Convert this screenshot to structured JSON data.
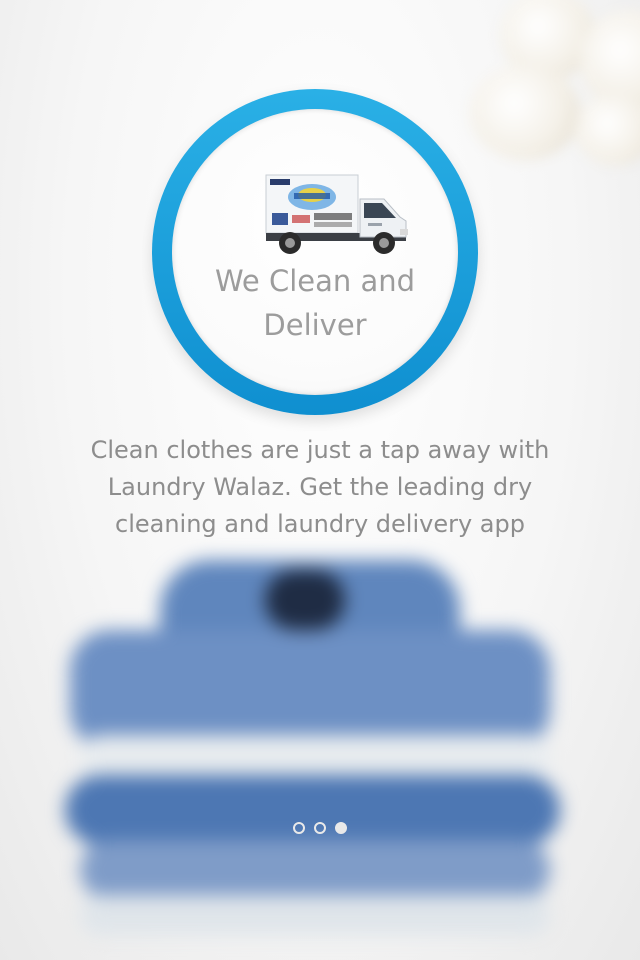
{
  "onboarding": {
    "slide_title": "We Clean and Deliver",
    "description": "Clean clothes are just a tap away with Laundry Walaz. Get the leading dry cleaning and laundry delivery app",
    "accent_color": "#1aa0dc",
    "slide_count": 3,
    "active_slide": 3,
    "illustration_icon": "delivery-truck-icon",
    "background_images": [
      "white-flowers",
      "folded-blue-shirts"
    ]
  }
}
